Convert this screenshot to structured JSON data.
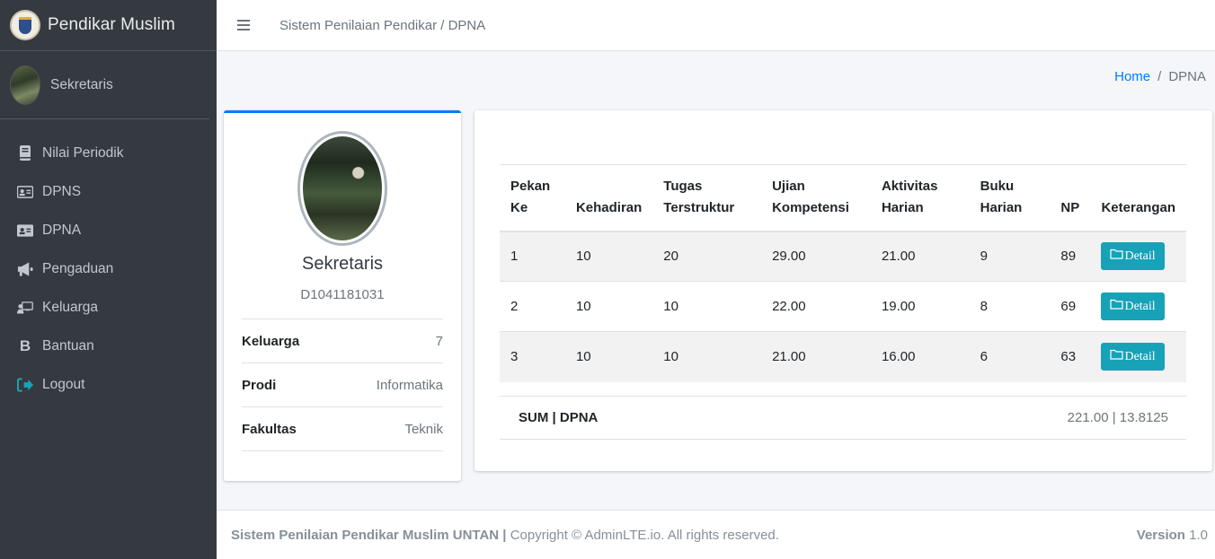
{
  "brand": {
    "title": "Pendikar Muslim"
  },
  "user": {
    "name": "Sekretaris"
  },
  "nav": [
    {
      "label": "Nilai Periodik",
      "icon": "book-icon"
    },
    {
      "label": "DPNS",
      "icon": "id-card-icon"
    },
    {
      "label": "DPNA",
      "icon": "id-card-icon"
    },
    {
      "label": "Pengaduan",
      "icon": "bullhorn-icon"
    },
    {
      "label": "Keluarga",
      "icon": "chalkboard-user-icon"
    },
    {
      "label": "Bantuan",
      "icon": "bitcoin-icon"
    },
    {
      "label": "Logout",
      "icon": "sign-out-icon"
    }
  ],
  "header": {
    "title": "Sistem Penilaian Pendikar / DPNA"
  },
  "breadcrumb": {
    "home": "Home",
    "separator": "/",
    "active": "DPNA"
  },
  "profile": {
    "name": "Sekretaris",
    "id": "D1041181031",
    "info": [
      {
        "label": "Keluarga",
        "value": "7"
      },
      {
        "label": "Prodi",
        "value": "Informatika"
      },
      {
        "label": "Fakultas",
        "value": "Teknik"
      }
    ]
  },
  "table": {
    "headers": [
      [
        "Pekan",
        "Ke"
      ],
      [
        "",
        "Kehadiran"
      ],
      [
        "Tugas",
        "Terstruktur"
      ],
      [
        "Ujian",
        "Kompetensi"
      ],
      [
        "Aktivitas",
        "Harian"
      ],
      [
        "Buku",
        "Harian"
      ],
      [
        "",
        "NP"
      ],
      [
        "",
        "Keterangan"
      ]
    ],
    "rows": [
      [
        "1",
        "10",
        "20",
        "29.00",
        "21.00",
        "9",
        "89"
      ],
      [
        "2",
        "10",
        "10",
        "22.00",
        "19.00",
        "8",
        "69"
      ],
      [
        "3",
        "10",
        "10",
        "21.00",
        "16.00",
        "6",
        "63"
      ]
    ],
    "detail_label": "Detail",
    "sum_label": "SUM | DPNA",
    "sum_value": "221.00 | 13.8125"
  },
  "footer": {
    "brand": "Sistem Penilaian Pendikar Muslim UNTAN",
    "separator": " | ",
    "copyright": "Copyright © AdminLTE.io. All rights reserved.",
    "version_label": "Version",
    "version": "1.0"
  },
  "colors": {
    "sidebar": "#343a40",
    "primary": "#007bff",
    "info": "#17a2b8",
    "stripe": "#f2f2f2"
  }
}
